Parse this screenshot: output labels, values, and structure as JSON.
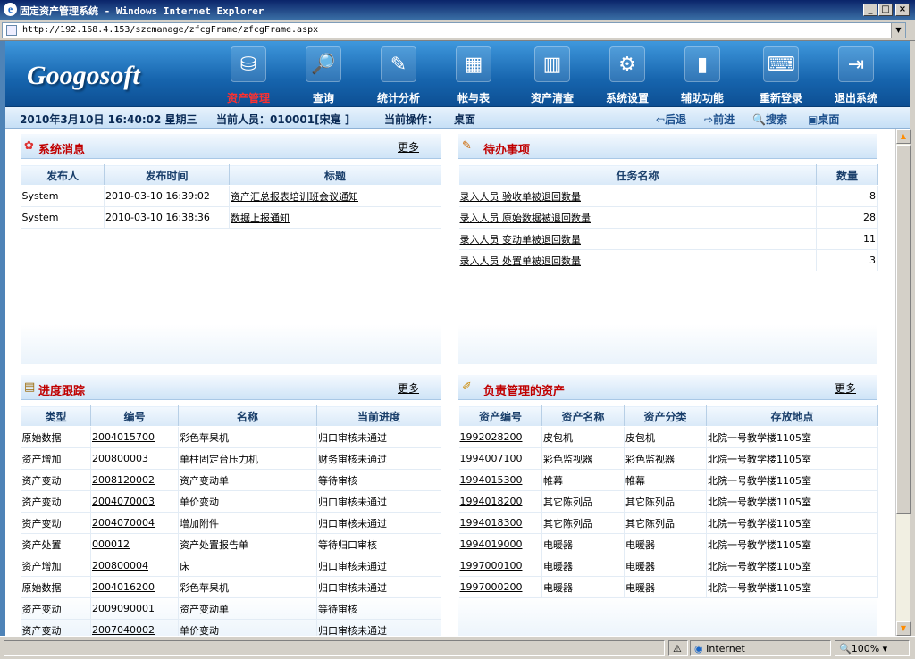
{
  "window": {
    "title": "固定资产管理系统 - Windows Internet Explorer",
    "url": "http://192.168.4.153/szcmanage/zfcgFrame/zfcgFrame.aspx"
  },
  "brand": {
    "logo": "Googosoft"
  },
  "nav": [
    {
      "label": "资产管理",
      "icon": "assets-icon",
      "active": true
    },
    {
      "label": "查询",
      "icon": "search-icon",
      "active": false
    },
    {
      "label": "统计分析",
      "icon": "statistics-icon",
      "active": false
    },
    {
      "label": "帐与表",
      "icon": "ledger-icon",
      "active": false
    },
    {
      "label": "资产清查",
      "icon": "inventory-icon",
      "active": false
    },
    {
      "label": "系统设置",
      "icon": "settings-icon",
      "active": false
    },
    {
      "label": "辅助功能",
      "icon": "books-icon",
      "active": false
    },
    {
      "label": "重新登录",
      "icon": "relogin-icon",
      "active": false
    },
    {
      "label": "退出系统",
      "icon": "exit-icon",
      "active": false
    }
  ],
  "status": {
    "datetime": "2010年3月10日 16:40:02 星期三",
    "user": "当前人员：010001[宋寔 ]",
    "op_label": "当前操作：",
    "op_value": "桌面",
    "back": "后退",
    "forward": "前进",
    "search": "搜索",
    "desktop": "桌面"
  },
  "panels": {
    "messages": {
      "title": "系统消息",
      "more": "更多",
      "columns": [
        "发布人",
        "发布时间",
        "标题"
      ],
      "rows": [
        [
          "System",
          "2010-03-10 16:39:02",
          "资产汇总报表培训班会议通知"
        ],
        [
          "System",
          "2010-03-10 16:38:36",
          "数据上报通知"
        ]
      ]
    },
    "todo": {
      "title": "待办事项",
      "columns": [
        "任务名称",
        "数量"
      ],
      "rows": [
        [
          "录入人员 验收单被退回数量",
          "8"
        ],
        [
          "录入人员 原始数据被退回数量",
          "28"
        ],
        [
          "录入人员 变动单被退回数量",
          "11"
        ],
        [
          "录入人员 处置单被退回数量",
          "3"
        ]
      ]
    },
    "progress": {
      "title": "进度跟踪",
      "more": "更多",
      "columns": [
        "类型",
        "编号",
        "名称",
        "当前进度"
      ],
      "rows": [
        [
          "原始数据",
          "2004015700",
          "彩色苹果机",
          "归口审核未通过"
        ],
        [
          "资产增加",
          "200800003",
          "单柱固定台压力机",
          "财务审核未通过"
        ],
        [
          "资产变动",
          "2008120002",
          "资产变动单",
          "等待审核"
        ],
        [
          "资产变动",
          "2004070003",
          "单价变动",
          "归口审核未通过"
        ],
        [
          "资产变动",
          "2004070004",
          "增加附件",
          "归口审核未通过"
        ],
        [
          "资产处置",
          "000012",
          "资产处置报告单",
          "等待归口审核"
        ],
        [
          "资产增加",
          "200800004",
          "床",
          "归口审核未通过"
        ],
        [
          "原始数据",
          "2004016200",
          "彩色苹果机",
          "归口审核未通过"
        ],
        [
          "资产变动",
          "2009090001",
          "资产变动单",
          "等待审核"
        ],
        [
          "资产变动",
          "2007040002",
          "单价变动",
          "归口审核未通过"
        ]
      ]
    },
    "assets": {
      "title": "负责管理的资产",
      "more": "更多",
      "columns": [
        "资产编号",
        "资产名称",
        "资产分类",
        "存放地点"
      ],
      "rows": [
        [
          "1992028200",
          "皮包机",
          "皮包机",
          "北院一号教学楼1105室"
        ],
        [
          "1994007100",
          "彩色监视器",
          "彩色监视器",
          "北院一号教学楼1105室"
        ],
        [
          "1994015300",
          "帷幕",
          "帷幕",
          "北院一号教学楼1105室"
        ],
        [
          "1994018200",
          "其它陈列品",
          "其它陈列品",
          "北院一号教学楼1105室"
        ],
        [
          "1994018300",
          "其它陈列品",
          "其它陈列品",
          "北院一号教学楼1105室"
        ],
        [
          "1994019000",
          "电暖器",
          "电暖器",
          "北院一号教学楼1105室"
        ],
        [
          "1997000100",
          "电暖器",
          "电暖器",
          "北院一号教学楼1105室"
        ],
        [
          "1997000200",
          "电暖器",
          "电暖器",
          "北院一号教学楼1105室"
        ]
      ]
    }
  },
  "statusbar": {
    "zone": "Internet",
    "zoom": "100%"
  }
}
